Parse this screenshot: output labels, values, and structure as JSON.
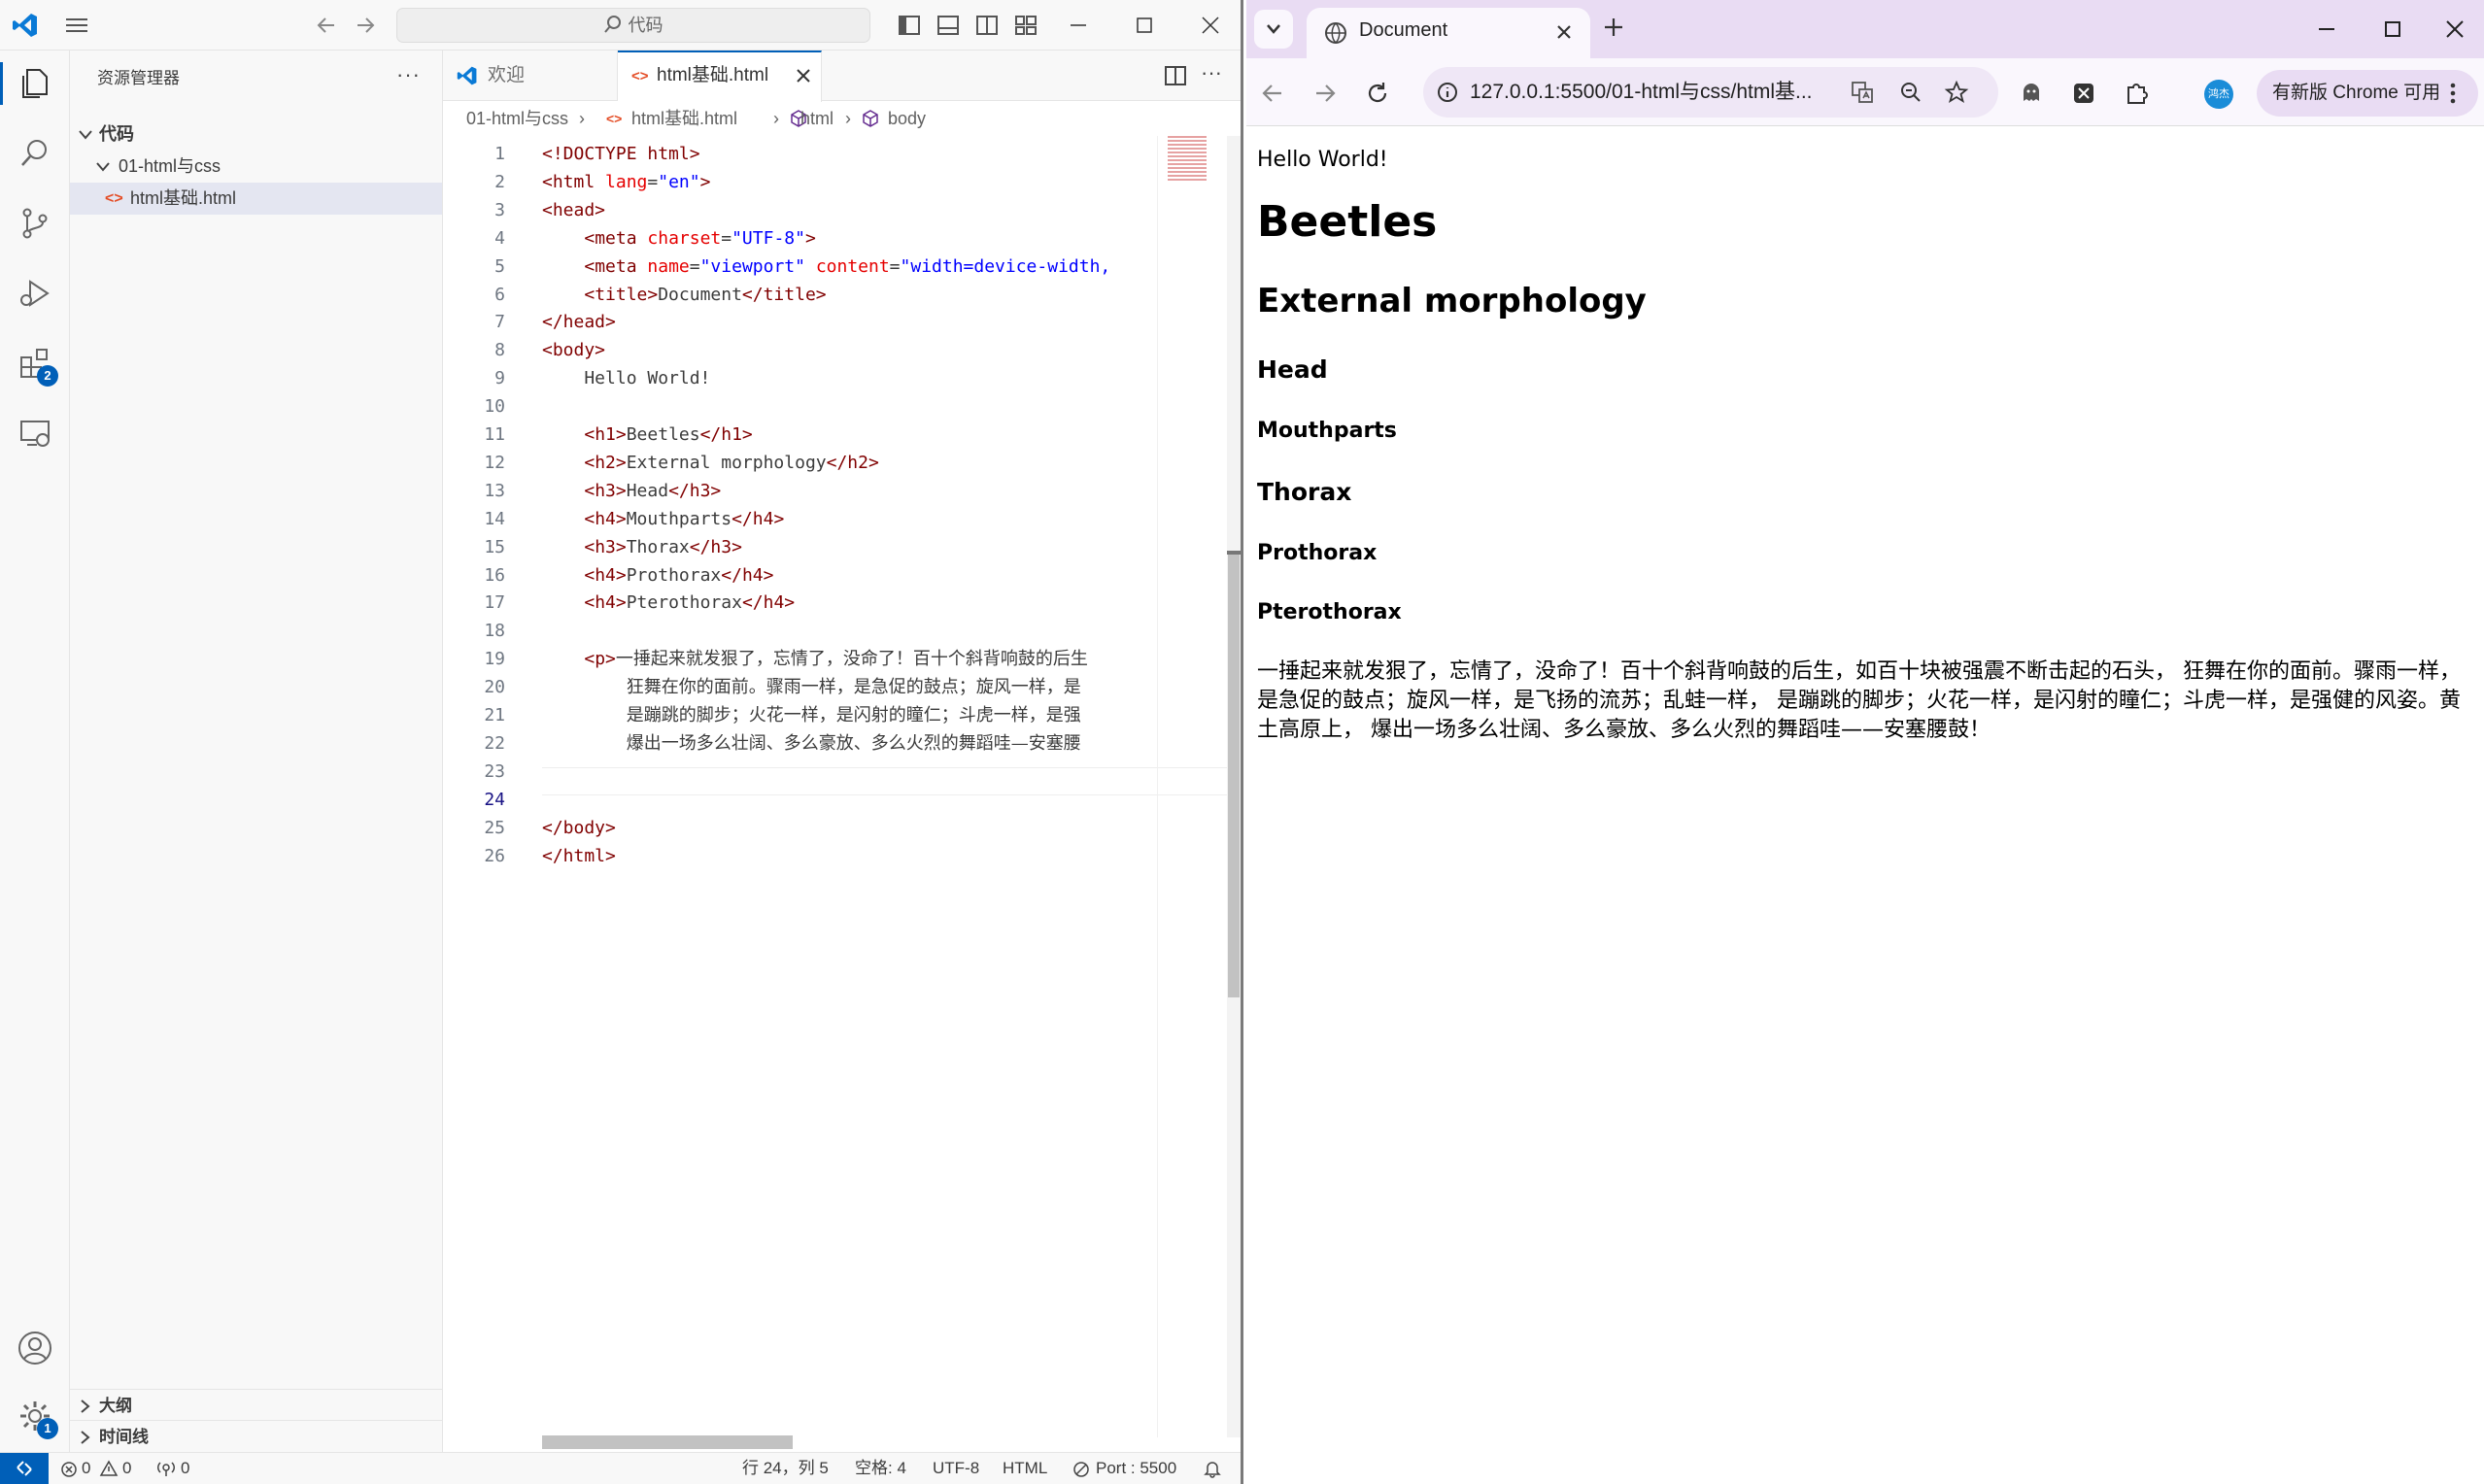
{
  "vscode": {
    "search_placeholder": "代码",
    "explorer_title": "资源管理器",
    "tree": {
      "root": "代码",
      "folder": "01-html与css",
      "file": "html基础.html"
    },
    "outline": "大纲",
    "timeline": "时间线",
    "tabs": {
      "welcome": "欢迎",
      "file": "html基础.html"
    },
    "extension_badge": "2",
    "settings_badge": "1",
    "breadcrumb": [
      "01-html与css",
      "html基础.html",
      "html",
      "body"
    ],
    "code": [
      {
        "n": "1",
        "t": [
          [
            "tg",
            "<!DOCTYPE html>"
          ]
        ]
      },
      {
        "n": "2",
        "t": [
          [
            "tg",
            "<html "
          ],
          [
            "at",
            "lang"
          ],
          [
            "",
            "="
          ],
          [
            "av",
            "\"en\""
          ],
          [
            "tg",
            ">"
          ]
        ]
      },
      {
        "n": "3",
        "t": [
          [
            "tg",
            "<head>"
          ]
        ]
      },
      {
        "n": "4",
        "t": [
          [
            "",
            "    "
          ],
          [
            "tg",
            "<meta "
          ],
          [
            "at",
            "charset"
          ],
          [
            "",
            "="
          ],
          [
            "av",
            "\"UTF-8\""
          ],
          [
            "tg",
            ">"
          ]
        ]
      },
      {
        "n": "5",
        "t": [
          [
            "",
            "    "
          ],
          [
            "tg",
            "<meta "
          ],
          [
            "at",
            "name"
          ],
          [
            "",
            "="
          ],
          [
            "av",
            "\"viewport\""
          ],
          [
            "",
            " "
          ],
          [
            "at",
            "content"
          ],
          [
            "",
            "="
          ],
          [
            "av",
            "\"width=device-width,"
          ]
        ]
      },
      {
        "n": "6",
        "t": [
          [
            "",
            "    "
          ],
          [
            "tg",
            "<title>"
          ],
          [
            "",
            "Document"
          ],
          [
            "tg",
            "</title>"
          ]
        ]
      },
      {
        "n": "7",
        "t": [
          [
            "tg",
            "</head>"
          ]
        ]
      },
      {
        "n": "8",
        "t": [
          [
            "tg",
            "<body>"
          ]
        ]
      },
      {
        "n": "9",
        "t": [
          [
            "",
            "    Hello World!"
          ]
        ]
      },
      {
        "n": "10",
        "t": []
      },
      {
        "n": "11",
        "t": [
          [
            "",
            "    "
          ],
          [
            "tg",
            "<h1>"
          ],
          [
            "",
            "Beetles"
          ],
          [
            "tg",
            "</h1>"
          ]
        ]
      },
      {
        "n": "12",
        "t": [
          [
            "",
            "    "
          ],
          [
            "tg",
            "<h2>"
          ],
          [
            "",
            "External morphology"
          ],
          [
            "tg",
            "</h2>"
          ]
        ]
      },
      {
        "n": "13",
        "t": [
          [
            "",
            "    "
          ],
          [
            "tg",
            "<h3>"
          ],
          [
            "",
            "Head"
          ],
          [
            "tg",
            "</h3>"
          ]
        ]
      },
      {
        "n": "14",
        "t": [
          [
            "",
            "    "
          ],
          [
            "tg",
            "<h4>"
          ],
          [
            "",
            "Mouthparts"
          ],
          [
            "tg",
            "</h4>"
          ]
        ]
      },
      {
        "n": "15",
        "t": [
          [
            "",
            "    "
          ],
          [
            "tg",
            "<h3>"
          ],
          [
            "",
            "Thorax"
          ],
          [
            "tg",
            "</h3>"
          ]
        ]
      },
      {
        "n": "16",
        "t": [
          [
            "",
            "    "
          ],
          [
            "tg",
            "<h4>"
          ],
          [
            "",
            "Prothorax"
          ],
          [
            "tg",
            "</h4>"
          ]
        ]
      },
      {
        "n": "17",
        "t": [
          [
            "",
            "    "
          ],
          [
            "tg",
            "<h4>"
          ],
          [
            "",
            "Pterothorax"
          ],
          [
            "tg",
            "</h4>"
          ]
        ]
      },
      {
        "n": "18",
        "t": []
      },
      {
        "n": "19",
        "t": [
          [
            "",
            "    "
          ],
          [
            "tg",
            "<p>"
          ],
          [
            "cn",
            "一捶起来就发狠了，忘情了，没命了！百十个斜背响鼓的后生"
          ]
        ]
      },
      {
        "n": "20",
        "t": [
          [
            "",
            "        "
          ],
          [
            "cn",
            "狂舞在你的面前。骤雨一样，是急促的鼓点；旋风一样，是"
          ]
        ]
      },
      {
        "n": "21",
        "t": [
          [
            "",
            "        "
          ],
          [
            "cn",
            "是蹦跳的脚步；火花一样，是闪射的瞳仁；斗虎一样，是强"
          ]
        ]
      },
      {
        "n": "22",
        "t": [
          [
            "",
            "        "
          ],
          [
            "cn",
            "爆出一场多么壮阔、多么豪放、多么火烈的舞蹈哇—安塞腰"
          ]
        ]
      },
      {
        "n": "23",
        "t": []
      },
      {
        "n": "24",
        "t": []
      },
      {
        "n": "25",
        "t": [
          [
            "tg",
            "</body>"
          ]
        ]
      },
      {
        "n": "26",
        "t": [
          [
            "tg",
            "</html>"
          ]
        ]
      }
    ],
    "status": {
      "errors": "0",
      "warnings": "0",
      "ports": "0",
      "position": "行 24，列 5",
      "spaces": "空格: 4",
      "encoding": "UTF-8",
      "language": "HTML",
      "port": "Port : 5500"
    }
  },
  "chrome": {
    "tab_title": "Document",
    "url": "127.0.0.1:5500/01-html与css/html基...",
    "profile": "鸿杰",
    "update_button": "有新版 Chrome 可用",
    "page": {
      "text": "Hello World!",
      "h1": "Beetles",
      "h2": "External morphology",
      "h3_head": "Head",
      "h4_mouthparts": "Mouthparts",
      "h3_thorax": "Thorax",
      "h4_prothorax": "Prothorax",
      "h4_pterothorax": "Pterothorax",
      "paragraph": "一捶起来就发狠了，忘情了，没命了！百十个斜背响鼓的后生，如百十块被强震不断击起的石头， 狂舞在你的面前。骤雨一样，是急促的鼓点；旋风一样，是飞扬的流苏；乱蛙一样， 是蹦跳的脚步；火花一样，是闪射的瞳仁；斗虎一样，是强健的风姿。黄土高原上， 爆出一场多么壮阔、多么豪放、多么火烈的舞蹈哇——安塞腰鼓！"
    }
  },
  "colors": {
    "accent": "#005fb8",
    "chrome_frame": "#e9dcf3",
    "tag": "#800000",
    "attr": "#e50000",
    "value": "#0000ff"
  }
}
